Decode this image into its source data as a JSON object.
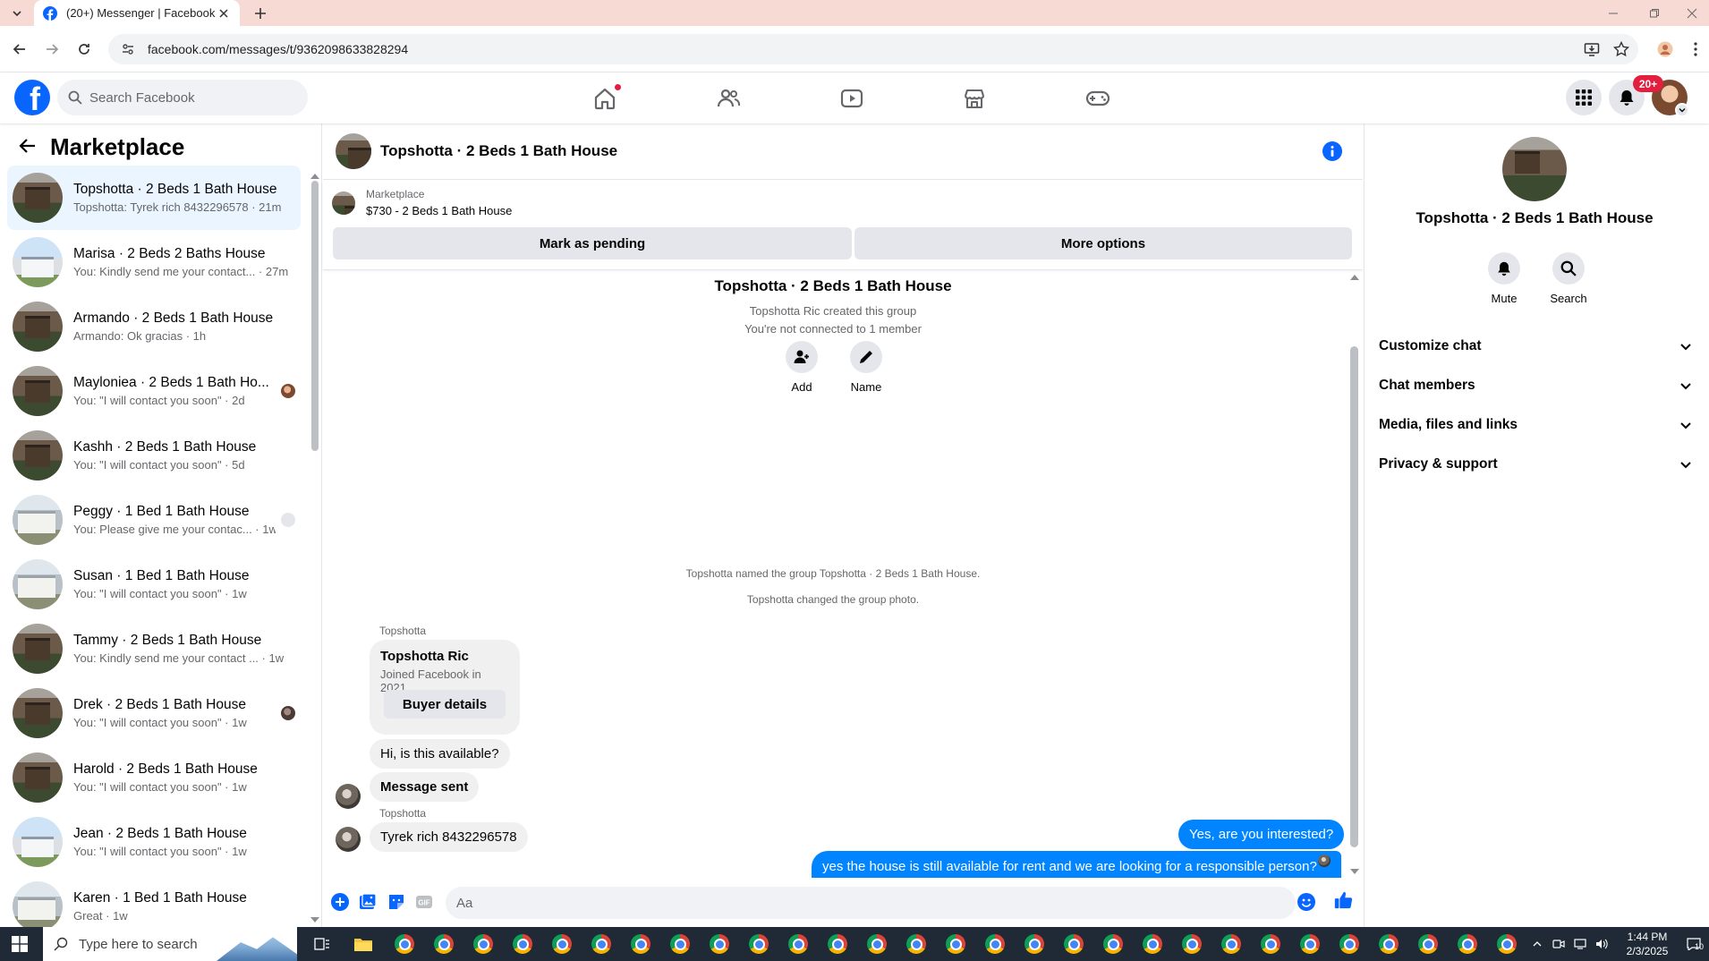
{
  "browser": {
    "tab_title": "(20+) Messenger | Facebook",
    "url": "facebook.com/messages/t/9362098633828294"
  },
  "header": {
    "search_placeholder": "Search Facebook",
    "notifications_badge": "20+"
  },
  "sidebar": {
    "title": "Marketplace",
    "conversations": [
      {
        "name": "Topshotta · 2 Beds 1 Bath House",
        "preview": "Topshotta: Tyrek rich 8432296578 · 21m",
        "avatar": "house",
        "active": true
      },
      {
        "name": "Marisa · 2 Beds 2 Baths House",
        "preview": "You: Kindly send me your contact... · 27m",
        "avatar": "blue"
      },
      {
        "name": "Armando · 2 Beds 1 Bath House",
        "preview": "Armando: Ok gracias · 1h",
        "avatar": "house"
      },
      {
        "name": "Mayloniea · 2 Beds 1 Bath Ho...",
        "preview": "You: \"I will contact you soon\" · 2d",
        "avatar": "house",
        "seen": "photo"
      },
      {
        "name": "Kashh · 2 Beds 1 Bath House",
        "preview": "You: \"I will contact you soon\" · 5d",
        "avatar": "house"
      },
      {
        "name": "Peggy · 1 Bed 1 Bath House",
        "preview": "You: Please give me your contac... · 1w",
        "avatar": "white",
        "seen": "default"
      },
      {
        "name": "Susan · 1 Bed 1 Bath House",
        "preview": "You: \"I will contact you soon\" · 1w",
        "avatar": "white"
      },
      {
        "name": "Tammy · 2 Beds 1 Bath House",
        "preview": "You: Kindly send me your contact ... · 1w",
        "avatar": "house"
      },
      {
        "name": "Drek · 2 Beds 1 Bath House",
        "preview": "You: \"I will contact you soon\" · 1w",
        "avatar": "house",
        "seen": "dark"
      },
      {
        "name": "Harold · 2 Beds 1 Bath House",
        "preview": "You: \"I will contact you soon\" · 1w",
        "avatar": "house"
      },
      {
        "name": "Jean · 2 Beds 1 Bath House",
        "preview": "You: \"I will contact you soon\" · 1w",
        "avatar": "blue"
      },
      {
        "name": "Karen · 1 Bed 1 Bath House",
        "preview": "Great · 1w",
        "avatar": "white"
      }
    ]
  },
  "chat": {
    "title": "Topshotta · 2 Beds 1 Bath House",
    "marketplace_label": "Marketplace",
    "listing": "$730 - 2 Beds 1 Bath House",
    "mark_pending": "Mark as pending",
    "more_options": "More options",
    "group_name": "Topshotta · 2 Beds 1 Bath House",
    "created_by": "Topshotta Ric created this group",
    "not_connected": "You're not connected to 1 member",
    "add_label": "Add",
    "name_label": "Name",
    "sys_named": "Topshotta named the group Topshotta · 2 Beds 1 Bath House.",
    "sys_photo": "Topshotta changed the group photo.",
    "sender": "Topshotta",
    "card_name": "Topshotta Ric",
    "card_joined": "Joined Facebook in 2021",
    "buyer_details": "Buyer details",
    "msg_available": "Hi, is this available?",
    "msg_sent": "Message sent",
    "msg_yes": "Yes, are you interested?",
    "msg_long": "yes the house is still available for rent and we are looking for a responsible person? When are you available to view? if you interested send me your good name and contact number  so I can contact with you.",
    "sender2": "Topshotta",
    "msg_phone": "Tyrek rich 8432296578",
    "composer_placeholder": "Aa"
  },
  "right_panel": {
    "name": "Topshotta · 2 Beds 1 Bath House",
    "mute": "Mute",
    "search": "Search",
    "sections": [
      "Customize chat",
      "Chat members",
      "Media, files and links",
      "Privacy & support"
    ]
  },
  "taskbar": {
    "search_placeholder": "Type here to search",
    "time": "1:44 PM",
    "date": "2/3/2025",
    "notif_count": "10"
  },
  "colors": {
    "fb_blue": "#0866ff",
    "messenger_blue": "#0084ff",
    "active_row": "#ebf5ff",
    "tabstrip": "#f7dad3"
  }
}
